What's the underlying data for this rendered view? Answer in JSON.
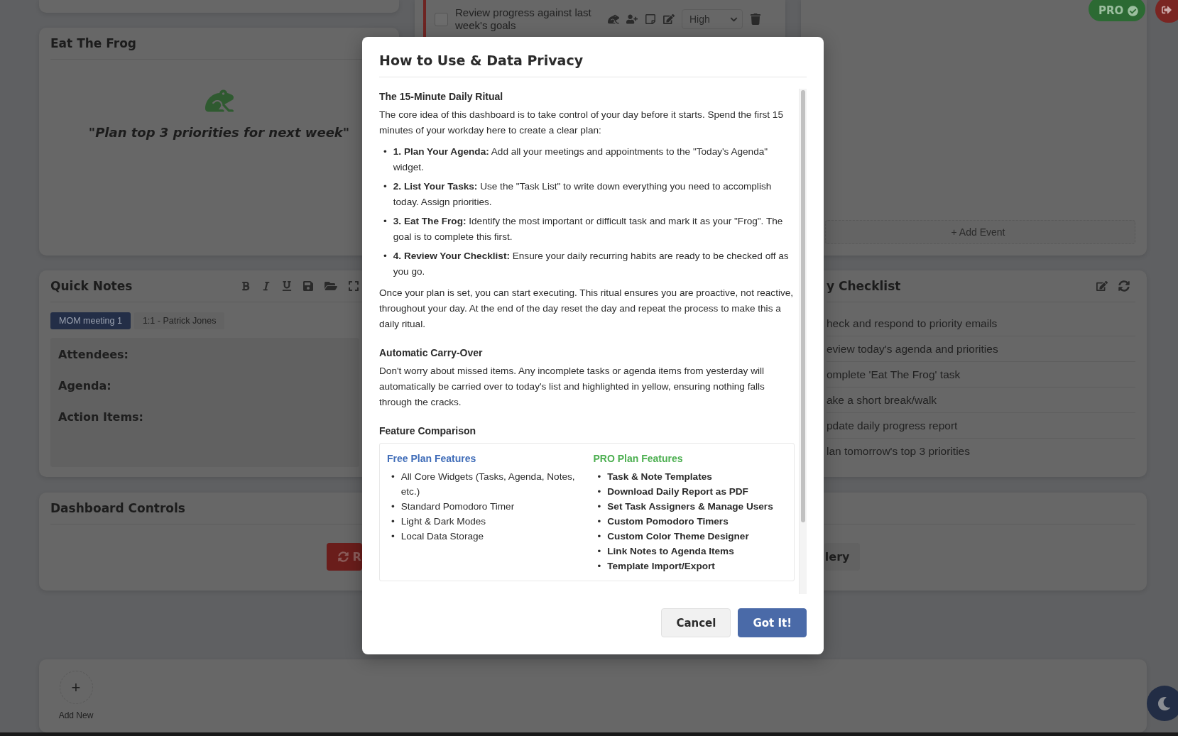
{
  "dashboard": {
    "eat_the_frog": {
      "title": "Eat The Frog",
      "frog_task": "\"Plan top 3 priorities for next week\""
    },
    "task": {
      "text": "Review progress against last week's goals",
      "checked": false,
      "priority": "High"
    },
    "agenda": {
      "add_event": "+ Add Event"
    },
    "quick_notes": {
      "title": "Quick Notes",
      "tabs": [
        {
          "label": "MOM meeting 1",
          "selected": true
        },
        {
          "label": "1:1 - Patrick Jones",
          "selected": false
        }
      ],
      "sections": [
        "Attendees:",
        "Agenda:",
        "Action Items:"
      ]
    },
    "checklist": {
      "title": "y Checklist",
      "items": [
        "heck and respond to priority emails",
        "eview today's agenda and priorities",
        "omplete 'Eat The Frog' task",
        "ake a short break/walk",
        "pdate daily progress report",
        "lan tomorrow's top 3 priorities"
      ]
    },
    "controls": {
      "title": "Dashboard Controls",
      "buttons": [
        {
          "label": "R",
          "kind": "danger"
        },
        {
          "label": "lery",
          "kind": "neutral"
        }
      ]
    },
    "add_new": {
      "symbol": "+",
      "label": "Add New"
    },
    "pro_badge": "PRO"
  },
  "modal": {
    "title": "How to Use & Data Privacy",
    "sections": [
      {
        "heading": "The 15-Minute Daily Ritual",
        "blocks": [
          {
            "kind": "paragraph",
            "text": "The core idea of this dashboard is to take control of your day before it starts. Spend the first 15 minutes of your workday here to create a clear plan:"
          },
          {
            "kind": "list",
            "marker": "•",
            "items": [
              "**1. Plan Your Agenda:** Add all your meetings and appointments to the \"Today's Agenda\" widget.",
              "**2. List Your Tasks:** Use the \"Task List\" to write down everything you need to accomplish today. Assign priorities.",
              "**3. Eat The Frog:** Identify the most important or difficult task and mark it as your \"Frog\". The goal is to complete this first.",
              "**4. Review Your Checklist:** Ensure your daily recurring habits are ready to be checked off as you go."
            ]
          },
          {
            "kind": "paragraph",
            "text": "Once your plan is set, you can start executing. This ritual ensures you are proactive, not reactive, throughout your day. At the end of the day reset the day and repeat the process to make this a daily ritual."
          }
        ]
      },
      {
        "heading": "Automatic Carry-Over",
        "blocks": [
          {
            "kind": "paragraph",
            "text": "Don't worry about missed items. Any incomplete tasks or agenda items from yesterday will automatically be carried over to today's list and highlighted in yellow, ensuring nothing falls through the cracks."
          }
        ]
      },
      {
        "heading": "Feature Comparison",
        "blocks": [
          {
            "kind": "comparison",
            "plans": [
              {
                "title": "Free Plan Features",
                "color": "#3f6cb8",
                "emphasis": false,
                "marker": "•",
                "items": [
                  "All Core Widgets (Tasks, Agenda, Notes, etc.)",
                  "Standard Pomodoro Timer",
                  "Light & Dark Modes",
                  "Local Data Storage"
                ]
              },
              {
                "title": "PRO Plan Features",
                "color": "#4caf50",
                "emphasis": true,
                "marker": "•",
                "items": [
                  "Task & Note Templates",
                  "Download Daily Report as PDF",
                  "Set Task Assigners & Manage Users",
                  "Custom Pomodoro Timers",
                  "Custom Color Theme Designer",
                  "Link Notes to Agenda Items",
                  "Template Import/Export"
                ]
              }
            ]
          }
        ]
      }
    ],
    "buttons": [
      {
        "label": "Cancel",
        "kind": "secondary"
      },
      {
        "label": "Got It!",
        "kind": "primary"
      }
    ]
  }
}
